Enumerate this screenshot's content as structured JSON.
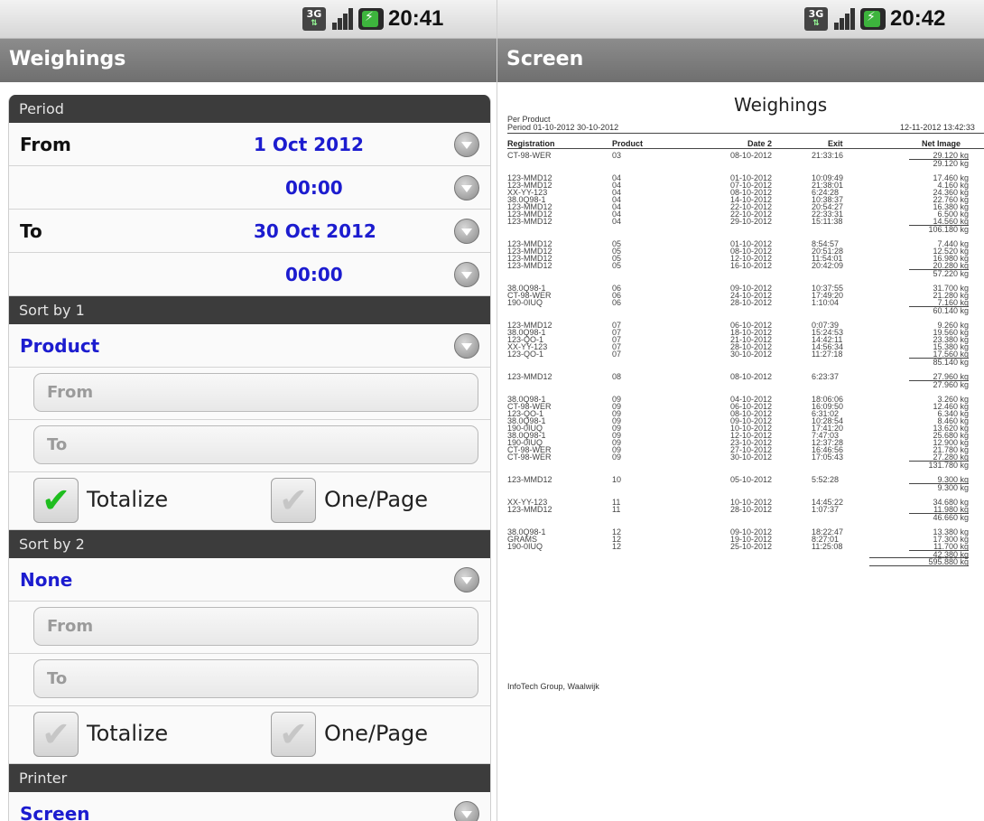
{
  "left": {
    "status": {
      "time": "20:41",
      "network": "3G"
    },
    "title": "Weighings",
    "period": {
      "header": "Period",
      "from_label": "From",
      "from_date": "1 Oct 2012",
      "from_time": "00:00",
      "to_label": "To",
      "to_date": "30 Oct 2012",
      "to_time": "00:00"
    },
    "sort1": {
      "header": "Sort by 1",
      "value": "Product",
      "from_placeholder": "From",
      "to_placeholder": "To",
      "totalize_label": "Totalize",
      "totalize_checked": true,
      "onepage_label": "One/Page",
      "onepage_checked": false
    },
    "sort2": {
      "header": "Sort by 2",
      "value": "None",
      "from_placeholder": "From",
      "to_placeholder": "To",
      "totalize_label": "Totalize",
      "totalize_checked": false,
      "onepage_label": "One/Page",
      "onepage_checked": false
    },
    "printer": {
      "header": "Printer",
      "value": "Screen"
    }
  },
  "right": {
    "status": {
      "time": "20:42",
      "network": "3G"
    },
    "title": "Screen",
    "report": {
      "title": "Weighings",
      "subtitle": "Per Product",
      "period": "Period 01-10-2012 30-10-2012",
      "generated": "12-11-2012 13:42:33",
      "columns": {
        "registration": "Registration",
        "product": "Product",
        "date": "Date 2",
        "exit": "Exit",
        "net": "Net Image"
      },
      "groups": [
        {
          "rows": [
            [
              "CT-98-WER",
              "03",
              "08-10-2012",
              "21:33:16",
              "29.120 kg"
            ]
          ],
          "total": "29.120 kg"
        },
        {
          "rows": [
            [
              "123-MMD12",
              "04",
              "01-10-2012",
              "10:09:49",
              "17.460 kg"
            ],
            [
              "123-MMD12",
              "04",
              "07-10-2012",
              "21:38:01",
              "4.160 kg"
            ],
            [
              "XX-YY-123",
              "04",
              "08-10-2012",
              "6:24:28",
              "24.360 kg"
            ],
            [
              "38.0Q98-1",
              "04",
              "14-10-2012",
              "10:38:37",
              "22.760 kg"
            ],
            [
              "123-MMD12",
              "04",
              "22-10-2012",
              "20:54:27",
              "16.380 kg"
            ],
            [
              "123-MMD12",
              "04",
              "22-10-2012",
              "22:33:31",
              "6.500 kg"
            ],
            [
              "123-MMD12",
              "04",
              "29-10-2012",
              "15:11:38",
              "14.560 kg"
            ]
          ],
          "total": "106.180 kg"
        },
        {
          "rows": [
            [
              "123-MMD12",
              "05",
              "01-10-2012",
              "8:54:57",
              "7.440 kg"
            ],
            [
              "123-MMD12",
              "05",
              "08-10-2012",
              "20:51:28",
              "12.520 kg"
            ],
            [
              "123-MMD12",
              "05",
              "12-10-2012",
              "11:54:01",
              "16.980 kg"
            ],
            [
              "123-MMD12",
              "05",
              "16-10-2012",
              "20:42:09",
              "20.280 kg"
            ]
          ],
          "total": "57.220 kg"
        },
        {
          "rows": [
            [
              "38.0Q98-1",
              "06",
              "09-10-2012",
              "10:37:55",
              "31.700 kg"
            ],
            [
              "CT-98-WER",
              "06",
              "24-10-2012",
              "17:49:20",
              "21.280 kg"
            ],
            [
              "190-0IUQ",
              "06",
              "28-10-2012",
              "1:10:04",
              "7.160 kg"
            ]
          ],
          "total": "60.140 kg"
        },
        {
          "rows": [
            [
              "123-MMD12",
              "07",
              "06-10-2012",
              "0:07:39",
              "9.260 kg"
            ],
            [
              "38.0Q98-1",
              "07",
              "18-10-2012",
              "15:24:53",
              "19.560 kg"
            ],
            [
              "123-QO-1",
              "07",
              "21-10-2012",
              "14:42:11",
              "23.380 kg"
            ],
            [
              "XX-YY-123",
              "07",
              "28-10-2012",
              "14:56:34",
              "15.380 kg"
            ],
            [
              "123-QO-1",
              "07",
              "30-10-2012",
              "11:27:18",
              "17.560 kg"
            ]
          ],
          "total": "85.140 kg"
        },
        {
          "rows": [
            [
              "123-MMD12",
              "08",
              "08-10-2012",
              "6:23:37",
              "27.960 kg"
            ]
          ],
          "total": "27.960 kg"
        },
        {
          "rows": [
            [
              "38.0Q98-1",
              "09",
              "04-10-2012",
              "18:06:06",
              "3.260 kg"
            ],
            [
              "CT-98-WER",
              "09",
              "06-10-2012",
              "16:09:50",
              "12.460 kg"
            ],
            [
              "123-QO-1",
              "09",
              "08-10-2012",
              "6:31:02",
              "6.340 kg"
            ],
            [
              "38.0Q98-1",
              "09",
              "09-10-2012",
              "10:28:54",
              "8.460 kg"
            ],
            [
              "190-0IUQ",
              "09",
              "10-10-2012",
              "17:41:20",
              "13.620 kg"
            ],
            [
              "38.0Q98-1",
              "09",
              "12-10-2012",
              "7:47:03",
              "25.680 kg"
            ],
            [
              "190-0IUQ",
              "09",
              "23-10-2012",
              "12:37:28",
              "12.900 kg"
            ],
            [
              "CT-98-WER",
              "09",
              "27-10-2012",
              "16:46:56",
              "21.780 kg"
            ],
            [
              "CT-98-WER",
              "09",
              "30-10-2012",
              "17:05:43",
              "27.280 kg"
            ]
          ],
          "total": "131.780 kg"
        },
        {
          "rows": [
            [
              "123-MMD12",
              "10",
              "05-10-2012",
              "5:52:28",
              "9.300 kg"
            ]
          ],
          "total": "9.300 kg"
        },
        {
          "rows": [
            [
              "XX-YY-123",
              "11",
              "10-10-2012",
              "14:45:22",
              "34.680 kg"
            ],
            [
              "123-MMD12",
              "11",
              "28-10-2012",
              "1:07:37",
              "11.980 kg"
            ]
          ],
          "total": "46.660 kg"
        },
        {
          "rows": [
            [
              "38.0Q98-1",
              "12",
              "09-10-2012",
              "18:22:47",
              "13.380 kg"
            ],
            [
              "GRAMS",
              "12",
              "19-10-2012",
              "8:27:01",
              "17.300 kg"
            ],
            [
              "190-0IUQ",
              "12",
              "25-10-2012",
              "11:25:08",
              "11.700 kg"
            ]
          ],
          "total": "42.380 kg"
        }
      ],
      "grand_total": "595.880 kg",
      "footer": "InfoTech Group, Waalwijk"
    }
  }
}
